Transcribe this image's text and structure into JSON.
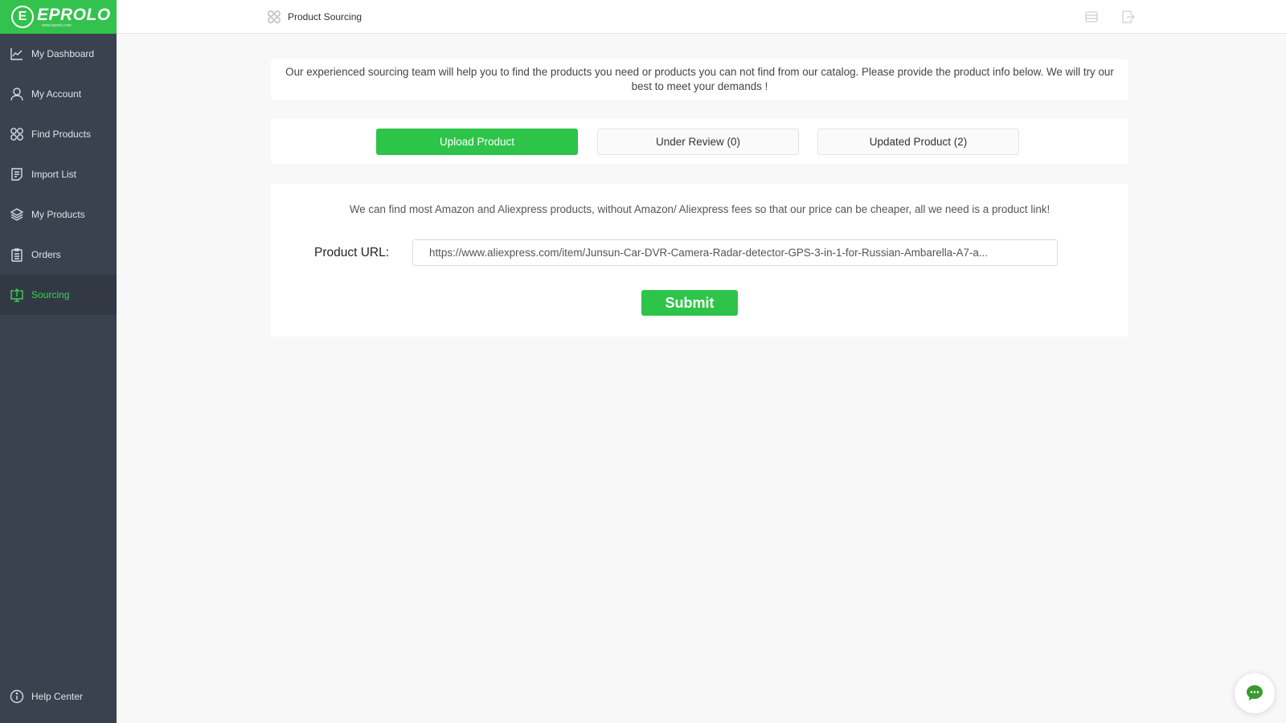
{
  "brand": {
    "name": "EPROLO",
    "mark": "E",
    "subtitle": "www.eprolo.com",
    "accent": "#2ec44a"
  },
  "sidebar": {
    "items": [
      {
        "label": "My Dashboard",
        "icon": "chart-line-icon"
      },
      {
        "label": "My Account",
        "icon": "user-icon"
      },
      {
        "label": "Find Products",
        "icon": "grid-circles-icon"
      },
      {
        "label": "Import List",
        "icon": "document-icon"
      },
      {
        "label": "My Products",
        "icon": "layers-icon"
      },
      {
        "label": "Orders",
        "icon": "clipboard-icon"
      },
      {
        "label": "Sourcing",
        "icon": "upload-monitor-icon",
        "active": true
      }
    ],
    "help": {
      "label": "Help Center",
      "icon": "info-icon"
    }
  },
  "header": {
    "breadcrumb": "Product Sourcing",
    "icons": [
      "storage-icon",
      "logout-icon"
    ]
  },
  "intro": {
    "text": "Our experienced sourcing team will help you to find the products you need or products you can not find from our catalog. Please provide the product info below. We will try our best to meet your demands !"
  },
  "tabs": [
    {
      "label": "Upload Product",
      "active": true
    },
    {
      "label": "Under Review (0)"
    },
    {
      "label": "Updated Product (2)"
    }
  ],
  "form": {
    "description": "We can find most Amazon and Aliexpress products, without Amazon/ Aliexpress fees so that our price can be cheaper, all we need is a product link!",
    "url_label": "Product URL:",
    "url_value": "https://www.aliexpress.com/item/Junsun-Car-DVR-Camera-Radar-detector-GPS-3-in-1-for-Russian-Ambarella-A7-a...",
    "submit_label": "Submit"
  },
  "chat": {
    "icon": "chat-bubble-icon"
  }
}
